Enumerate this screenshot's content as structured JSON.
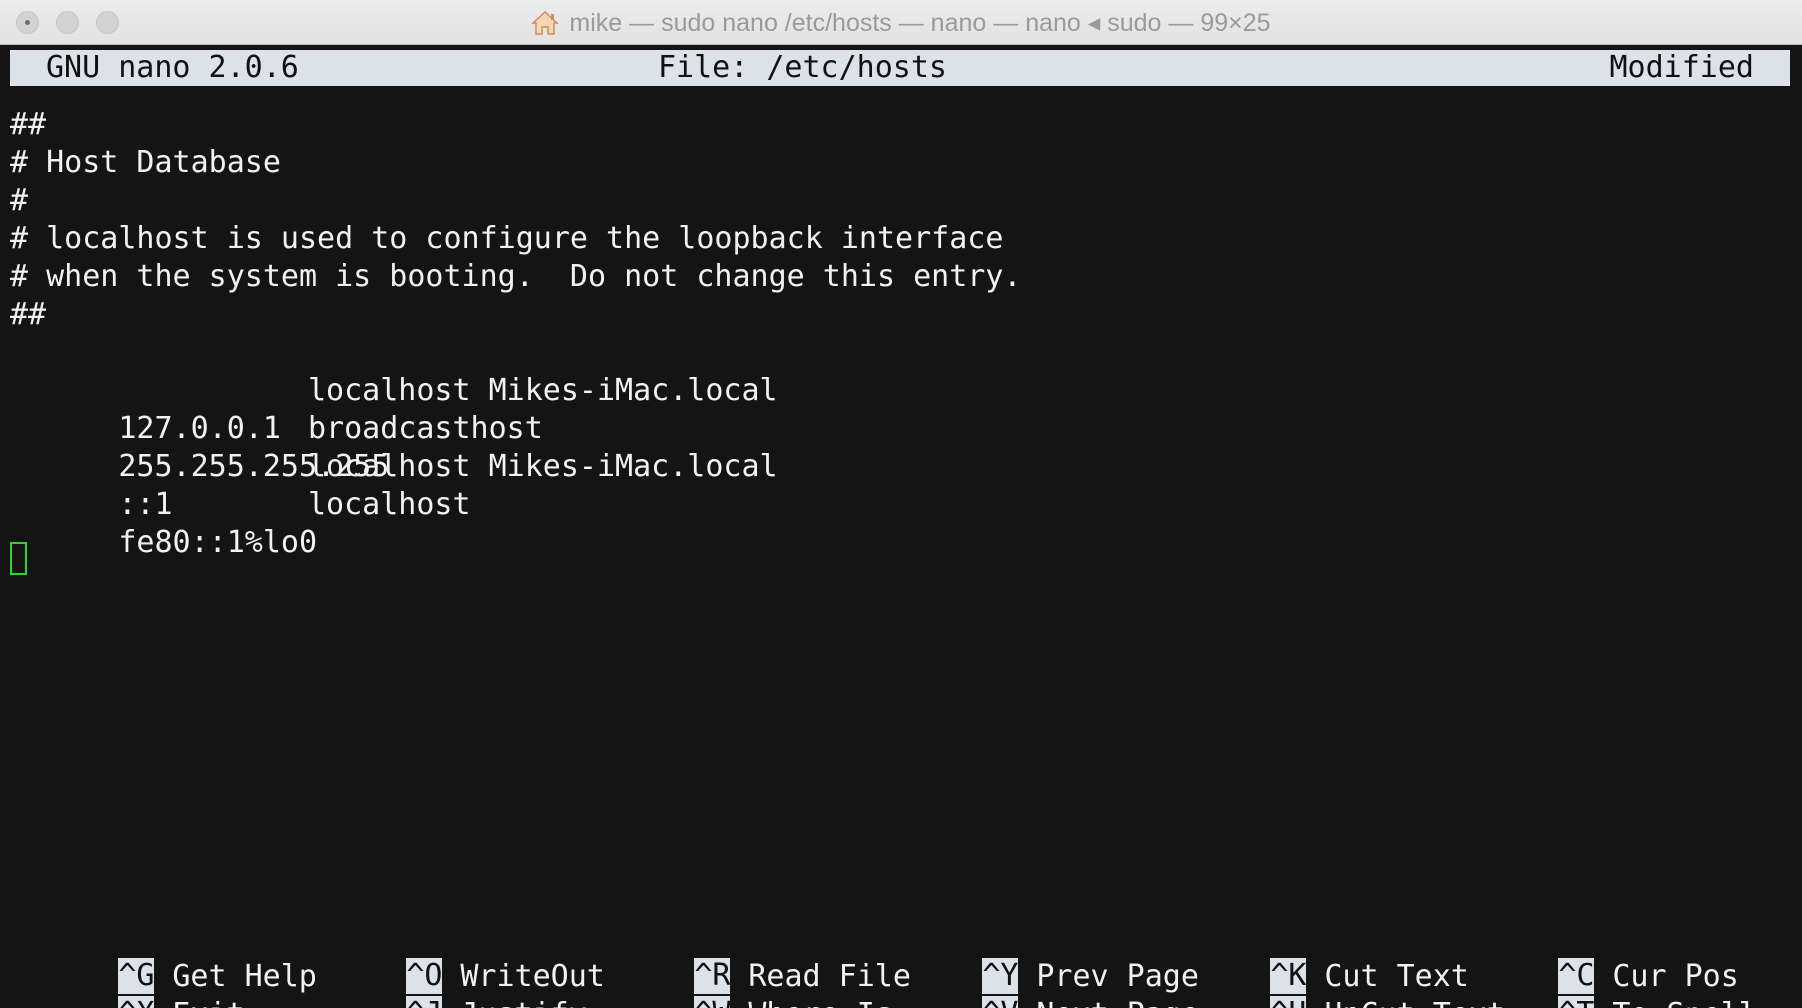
{
  "window": {
    "title": "mike — sudo nano /etc/hosts — nano — nano ◂ sudo — 99×25"
  },
  "nano": {
    "version": "GNU nano 2.0.6",
    "file_label": "File: /etc/hosts",
    "status": "Modified"
  },
  "file": {
    "comment_lines": [
      "##",
      "# Host Database",
      "#",
      "# localhost is used to configure the loopback interface",
      "# when the system is booting.  Do not change this entry.",
      "##"
    ],
    "hosts": [
      {
        "address": "127.0.0.1",
        "names": "localhost Mikes-iMac.local"
      },
      {
        "address": "255.255.255.255",
        "names": "broadcasthost"
      },
      {
        "address": "::1",
        "names": "localhost Mikes-iMac.local"
      },
      {
        "address": "fe80::1%lo0",
        "names": "localhost"
      }
    ]
  },
  "shortcuts": [
    {
      "key": "^G",
      "label": "Get Help"
    },
    {
      "key": "^X",
      "label": "Exit"
    },
    {
      "key": "^O",
      "label": "WriteOut"
    },
    {
      "key": "^J",
      "label": "Justify"
    },
    {
      "key": "^R",
      "label": "Read File"
    },
    {
      "key": "^W",
      "label": "Where Is"
    },
    {
      "key": "^Y",
      "label": "Prev Page"
    },
    {
      "key": "^V",
      "label": "Next Page"
    },
    {
      "key": "^K",
      "label": "Cut Text"
    },
    {
      "key": "^U",
      "label": "UnCut Text"
    },
    {
      "key": "^C",
      "label": "Cur Pos"
    },
    {
      "key": "^T",
      "label": "To Spell"
    }
  ],
  "colors": {
    "background": "#141414",
    "text": "#f2f2f2",
    "header_bar": "#dde1e8",
    "cursor": "#2bd62b"
  },
  "icons": {
    "title_icon": "home-icon"
  }
}
